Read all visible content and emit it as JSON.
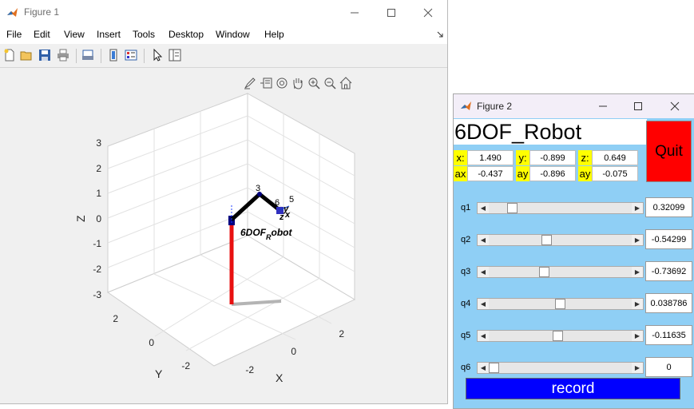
{
  "figure1": {
    "title": "Figure 1",
    "menu": [
      "File",
      "Edit",
      "View",
      "Insert",
      "Tools",
      "Desktop",
      "Window",
      "Help"
    ],
    "toolbar_icons": [
      "new-file-icon",
      "open-file-icon",
      "save-icon",
      "print-icon",
      "print-preview-icon",
      "colorbar-icon",
      "legend-icon",
      "pointer-icon",
      "property-editor-icon"
    ],
    "axes_toolbar_icons": [
      "brush-icon",
      "data-tips-icon",
      "rotate-3d-icon",
      "pan-icon",
      "zoom-in-icon",
      "zoom-out-icon",
      "home-icon"
    ],
    "plot": {
      "z_ticks": [
        "3",
        "2",
        "1",
        "0",
        "-1",
        "-2",
        "-3"
      ],
      "y_ticks": [
        "2",
        "0",
        "-2"
      ],
      "x_ticks": [
        "-2",
        "0",
        "2"
      ],
      "xlabel": "X",
      "ylabel": "Y",
      "zlabel": "Z",
      "label_main": "6DOF",
      "label_sub": "R",
      "label_rest": "obot",
      "joint_labels": [
        "3",
        "6",
        "5",
        "y",
        "z",
        "x"
      ]
    },
    "colors": {
      "link_base": "#e81010",
      "link_arm": "#000000",
      "joint": "#000080",
      "shadow": "#b4b4b4"
    }
  },
  "figure2": {
    "title": "Figure 2",
    "robot_name": "6DOF_Robot",
    "quit_label": "Quit",
    "record_label": "record",
    "position": [
      {
        "label": "x:",
        "value": "1.490"
      },
      {
        "label": "y:",
        "value": "-0.899"
      },
      {
        "label": "z:",
        "value": "0.649"
      }
    ],
    "orientation": [
      {
        "label": "ax",
        "value": "-0.437"
      },
      {
        "label": "ay",
        "value": "-0.896"
      },
      {
        "label": "ay",
        "value": "-0.075"
      }
    ],
    "joints": [
      {
        "label": "q1",
        "value": "0.32099",
        "slider_fraction": 0.14
      },
      {
        "label": "q2",
        "value": "-0.54299",
        "slider_fraction": 0.4
      },
      {
        "label": "q3",
        "value": "-0.73692",
        "slider_fraction": 0.38
      },
      {
        "label": "q4",
        "value": "0.038786",
        "slider_fraction": 0.5
      },
      {
        "label": "q5",
        "value": "-0.11635",
        "slider_fraction": 0.48
      },
      {
        "label": "q6",
        "value": "0",
        "slider_fraction": 0.0
      }
    ],
    "colors": {
      "background": "#8fcff5",
      "quit": "#ff0000",
      "record": "#0000ff",
      "label_bg": "#ffff00"
    }
  }
}
